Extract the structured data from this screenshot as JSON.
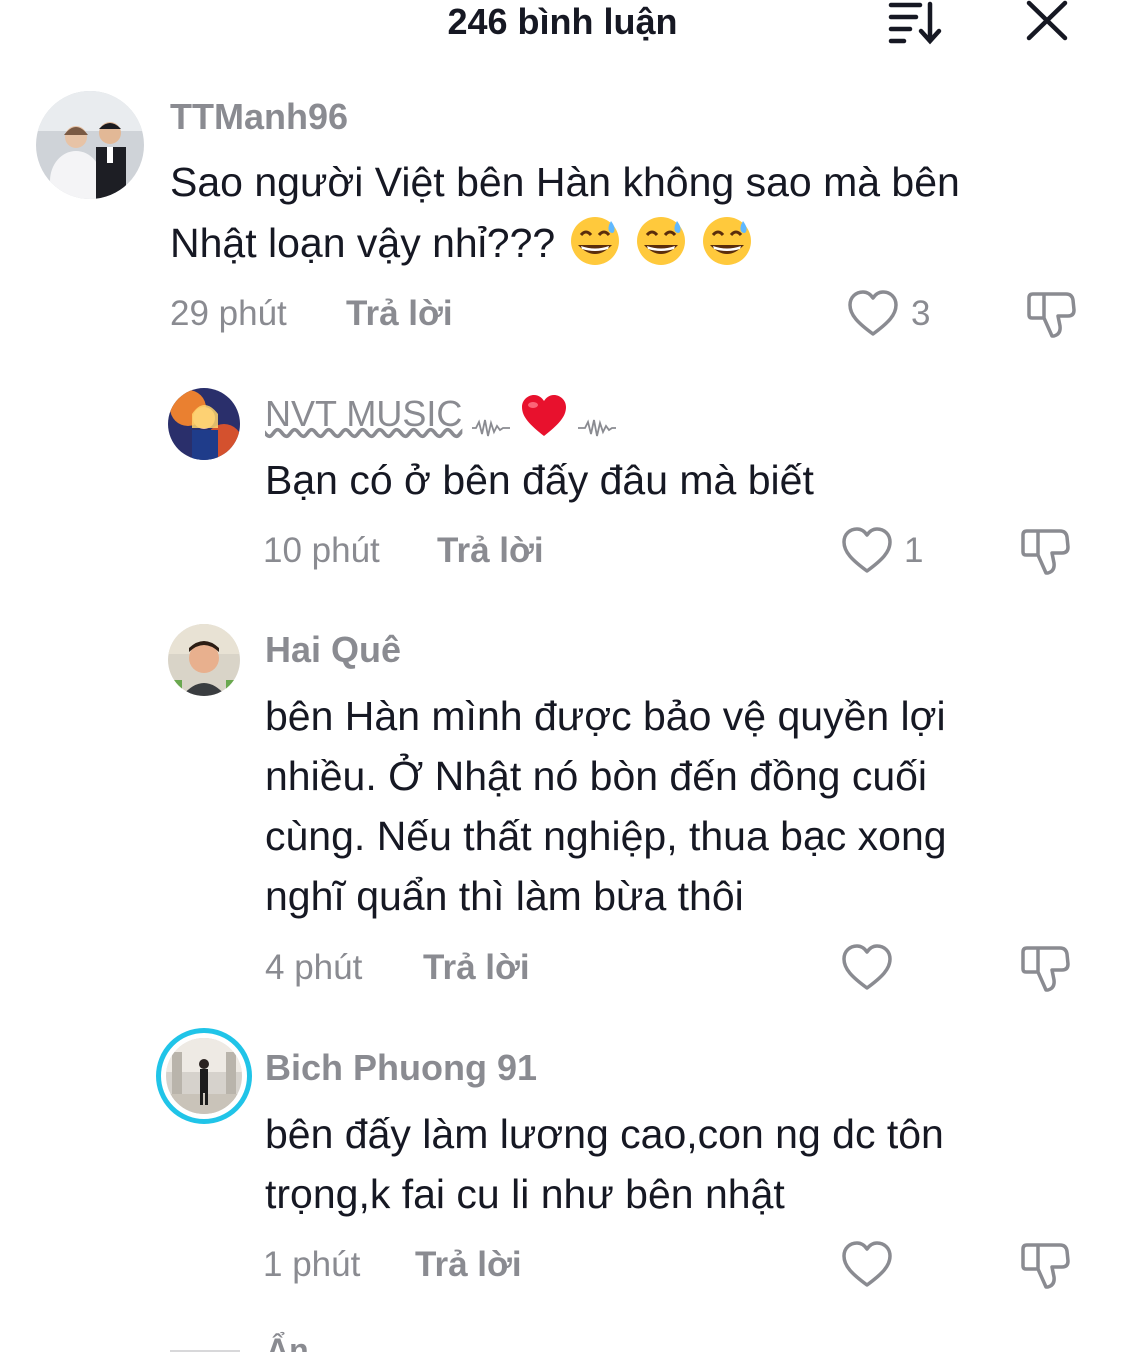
{
  "header": {
    "title": "246 bình luận",
    "sort_icon": "sort-icon",
    "close_icon": "close-icon"
  },
  "comments": [
    {
      "username": "TTManh96",
      "text_lines": [
        "Sao người Việt bên Hàn không sao mà bên",
        "Nhật loạn vậy nhỉ???"
      ],
      "emoji": [
        "sweat-smile-emoji",
        "sweat-smile-emoji",
        "sweat-smile-emoji"
      ],
      "time": "29 phút",
      "reply_label": "Trả lời",
      "likes": "3"
    },
    {
      "username": "NVT MUSIC",
      "username_suffix": "❤️",
      "text_lines": [
        "Bạn có ở bên đấy đâu mà biết"
      ],
      "time": "10 phút",
      "reply_label": "Trả lời",
      "likes": "1"
    },
    {
      "username": "Hai Quê",
      "text_lines": [
        "bên Hàn mình được bảo vệ quyền lợi",
        "nhiều. Ở Nhật nó bòn đến đồng cuối",
        "cùng. Nếu thất nghiệp, thua bạc xong",
        "nghĩ quẩn thì làm bừa thôi"
      ],
      "time": "4 phút",
      "reply_label": "Trả lời",
      "likes": ""
    },
    {
      "username": "Bich Phuong 91",
      "text_lines": [
        "bên đấy làm lương cao,con ng dc tôn",
        "trọng,k fai cu li như bên nhật"
      ],
      "time": "1 phút",
      "reply_label": "Trả lời",
      "likes": ""
    }
  ],
  "footer": {
    "hide_label": "Ẩn"
  },
  "colors": {
    "text": "#161823",
    "muted": "#8a8b91",
    "story_ring": "#20c4e8",
    "heart": "#e8112d"
  }
}
